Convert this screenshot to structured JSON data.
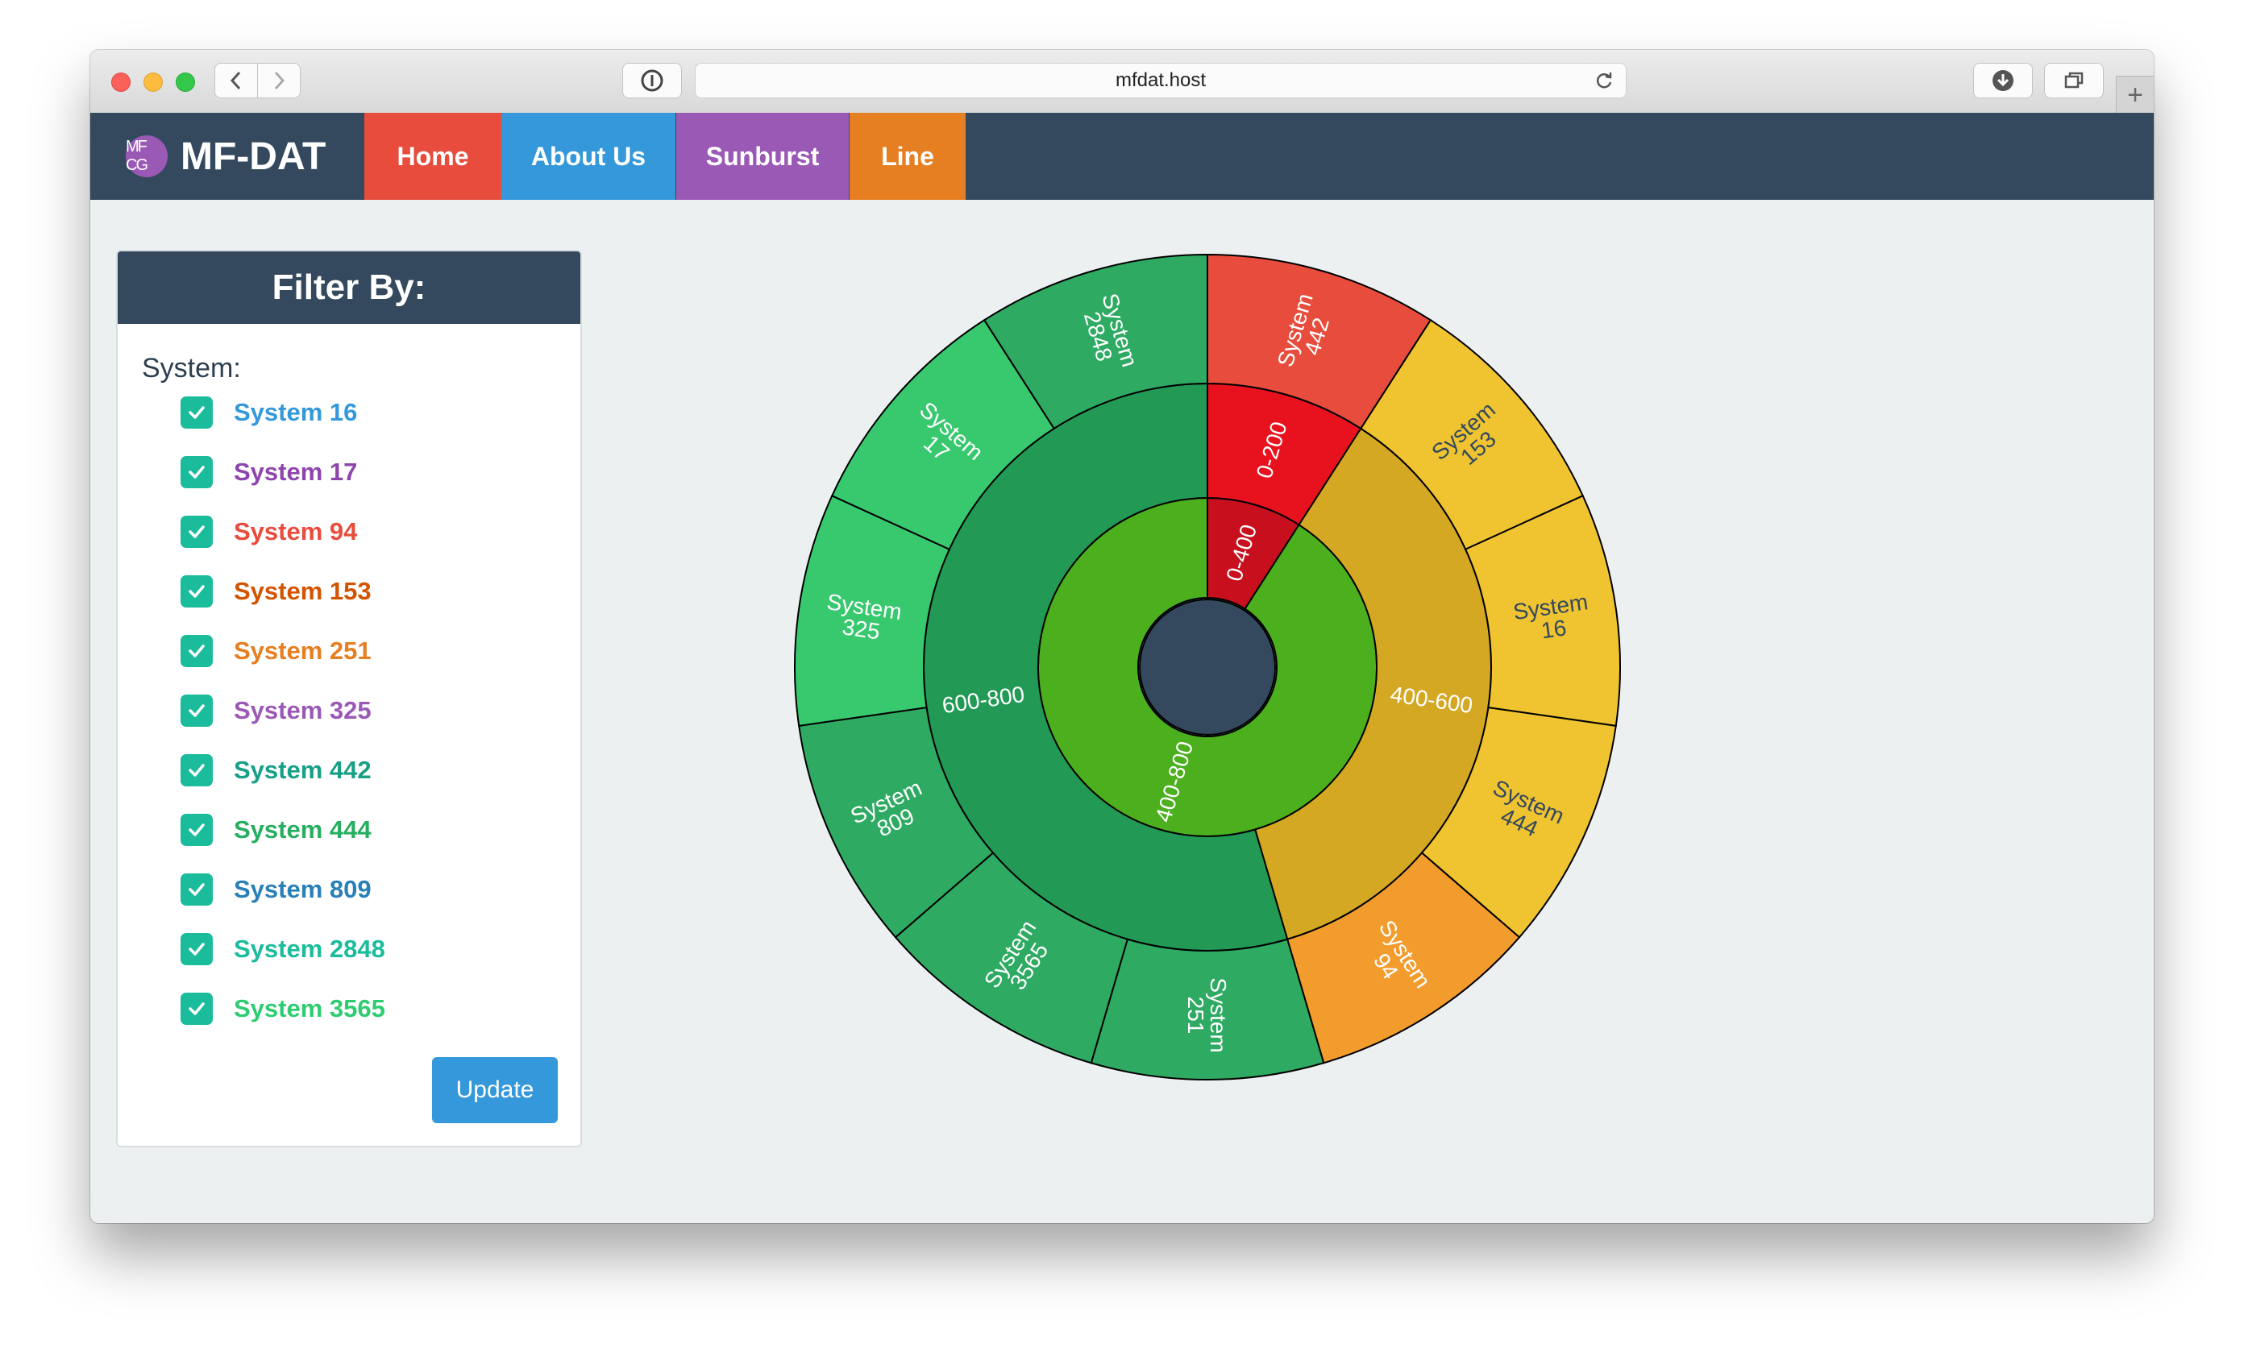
{
  "browser": {
    "url": "mfdat.host"
  },
  "navbar": {
    "brand": "MF-DAT",
    "brand_logo_text": "MF CG",
    "items": [
      {
        "label": "Home",
        "color": "#e74c3c"
      },
      {
        "label": "About Us",
        "color": "#3498db"
      },
      {
        "label": "Sunburst",
        "color": "#9b59b6"
      },
      {
        "label": "Line",
        "color": "#e67e22"
      }
    ]
  },
  "filter": {
    "title": "Filter By:",
    "group_label": "System:",
    "items": [
      {
        "label": "System 16",
        "checked": true,
        "color": "#3498db"
      },
      {
        "label": "System 17",
        "checked": true,
        "color": "#8e44ad"
      },
      {
        "label": "System 94",
        "checked": true,
        "color": "#e74c3c"
      },
      {
        "label": "System 153",
        "checked": true,
        "color": "#d35400"
      },
      {
        "label": "System 251",
        "checked": true,
        "color": "#e67e22"
      },
      {
        "label": "System 325",
        "checked": true,
        "color": "#9b59b6"
      },
      {
        "label": "System 442",
        "checked": true,
        "color": "#16a085"
      },
      {
        "label": "System 444",
        "checked": true,
        "color": "#27ae60"
      },
      {
        "label": "System 809",
        "checked": true,
        "color": "#2980b9"
      },
      {
        "label": "System 2848",
        "checked": true,
        "color": "#1abc9c"
      },
      {
        "label": "System 3565",
        "checked": true,
        "color": "#2ecc71"
      }
    ],
    "update_label": "Update"
  },
  "chart_data": {
    "type": "sunburst",
    "levels": [
      {
        "name": "0-400",
        "value": 1,
        "color": "#c80f1e",
        "children": [
          {
            "name": "0-200",
            "value": 1,
            "color": "#e8121e",
            "children": [
              {
                "name": "System 442",
                "value": 1,
                "color": "#e74c3c"
              }
            ]
          }
        ]
      },
      {
        "name": "400-800",
        "value": 10,
        "color": "#4caf1e",
        "children": [
          {
            "name": "400-600",
            "value": 4,
            "color": "#d4a823",
            "children": [
              {
                "name": "System 153",
                "value": 1,
                "color": "#f0c330"
              },
              {
                "name": "System 16",
                "value": 1,
                "color": "#f0c330"
              },
              {
                "name": "System 444",
                "value": 1,
                "color": "#f0c330"
              },
              {
                "name": "System 94",
                "value": 1,
                "color": "#f39c2e"
              }
            ]
          },
          {
            "name": "600-800",
            "value": 6,
            "color": "#229a55",
            "children": [
              {
                "name": "System 251",
                "value": 1,
                "color": "#2eaa62"
              },
              {
                "name": "System 3565",
                "value": 1,
                "color": "#2eaa62"
              },
              {
                "name": "System 809",
                "value": 1,
                "color": "#2eaa62"
              },
              {
                "name": "System 325",
                "value": 1,
                "color": "#38c96f"
              },
              {
                "name": "System 17",
                "value": 1,
                "color": "#38c96f"
              },
              {
                "name": "System 2848",
                "value": 1,
                "color": "#2eaa62"
              }
            ]
          }
        ]
      }
    ],
    "center_color": "#34495e"
  }
}
